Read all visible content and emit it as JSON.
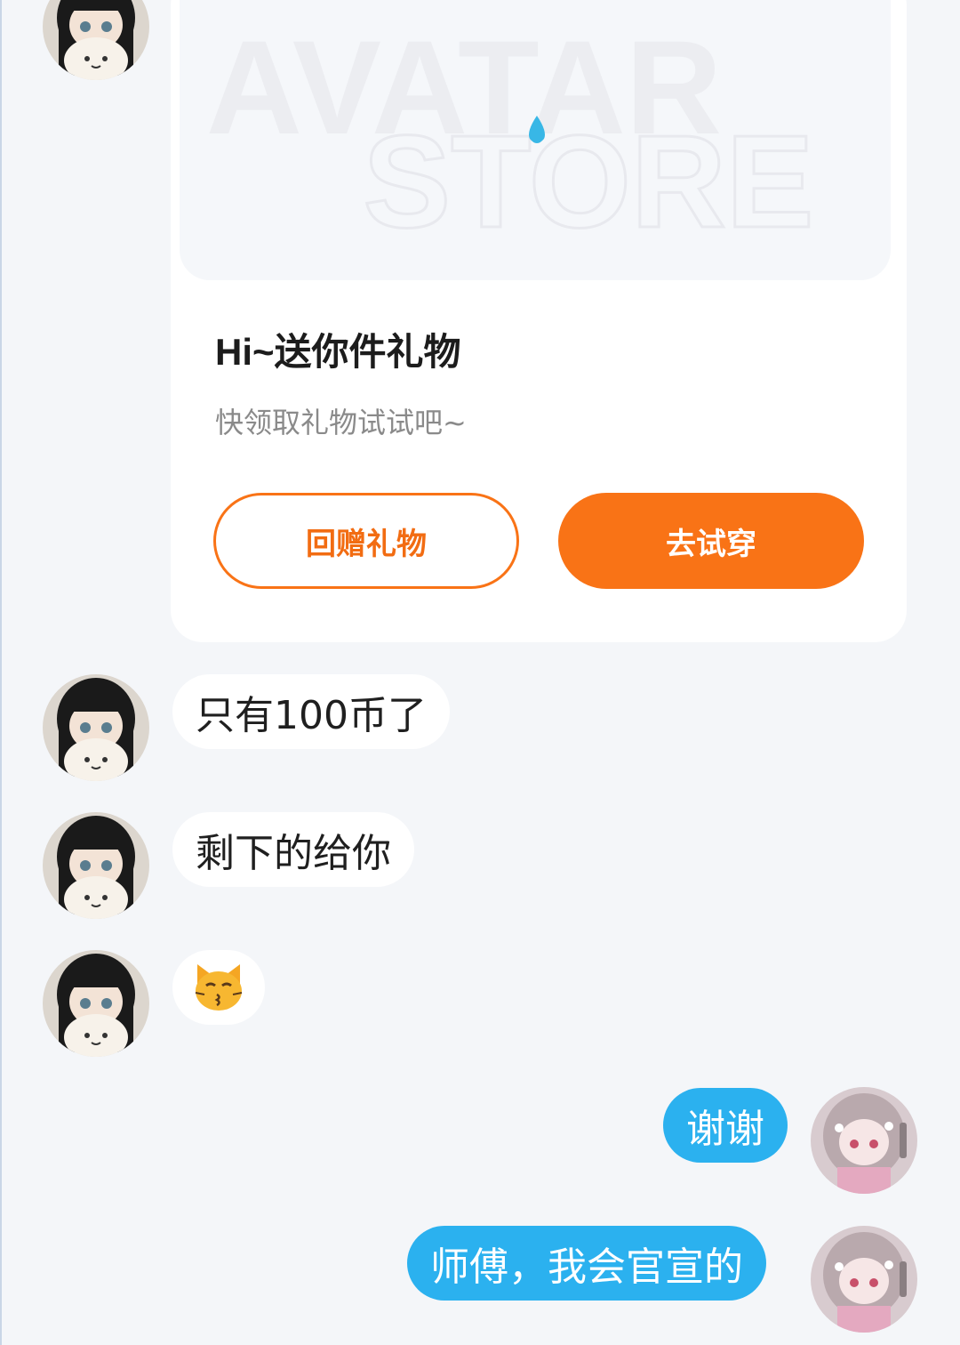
{
  "gift_card": {
    "banner_line1": "AVATAR",
    "banner_line2": "STORE",
    "title": "Hi~送你件礼物",
    "subtitle": "快领取礼物试试吧~",
    "return_gift_label": "回赠礼物",
    "try_on_label": "去试穿"
  },
  "messages": [
    {
      "sender": "other",
      "text": "只有100币了"
    },
    {
      "sender": "other",
      "text": "剩下的给你"
    },
    {
      "sender": "other",
      "text": "",
      "emoji": "kissing-cat"
    },
    {
      "sender": "me",
      "text": "谢谢"
    },
    {
      "sender": "me",
      "text": "师傅，我会官宣的"
    }
  ],
  "colors": {
    "accent_orange": "#f97316",
    "outgoing_bubble": "#2bb1ef",
    "background": "#f4f6f9"
  }
}
